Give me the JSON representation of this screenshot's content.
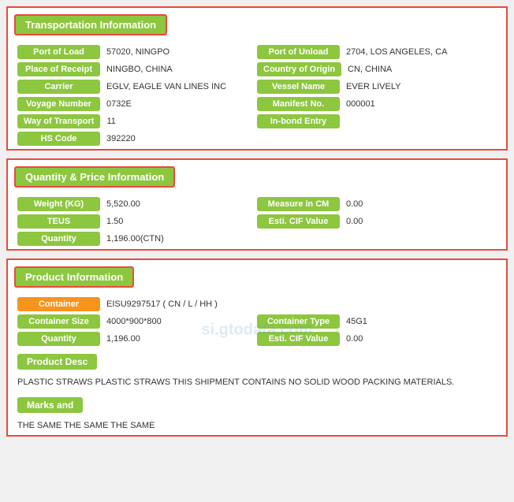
{
  "transportation": {
    "header": "Transportation Information",
    "fields": [
      {
        "label": "Port of Load",
        "value": "57020, NINGPO",
        "label2": "Port of Unload",
        "value2": "2704, LOS ANGELES, CA"
      },
      {
        "label": "Place of Receipt",
        "value": "NINGBO, CHINA",
        "label2": "Country of Origin",
        "value2": "CN, CHINA"
      },
      {
        "label": "Carrier",
        "value": "EGLV, EAGLE VAN LINES INC",
        "label2": "Vessel Name",
        "value2": "EVER LIVELY"
      },
      {
        "label": "Voyage Number",
        "value": "0732E",
        "label2": "Manifest No.",
        "value2": "000001"
      },
      {
        "label": "Way of Transport",
        "value": "11",
        "label2": "In-bond Entry",
        "value2": ""
      },
      {
        "label": "HS Code",
        "value": "392220",
        "label2": "",
        "value2": ""
      }
    ]
  },
  "quantity": {
    "header": "Quantity & Price Information",
    "fields": [
      {
        "label": "Weight (KG)",
        "value": "5,520.00",
        "label2": "Measure in CM",
        "value2": "0.00"
      },
      {
        "label": "TEUS",
        "value": "1.50",
        "label2": "Esti. CIF Value",
        "value2": "0.00"
      },
      {
        "label": "Quantity",
        "value": "1,196.00(CTN)",
        "label2": "",
        "value2": ""
      }
    ]
  },
  "product": {
    "header": "Product Information",
    "container_label": "Container",
    "container_value": "EISU9297517 ( CN / L / HH )",
    "fields": [
      {
        "label": "Container Size",
        "value": "4000*900*800",
        "label2": "Container Type",
        "value2": "45G1"
      },
      {
        "label": "Quantity",
        "value": "1,196.00",
        "label2": "Esti. CIF Value",
        "value2": "0.00"
      }
    ],
    "product_desc_label": "Product Desc",
    "product_desc_text": "PLASTIC STRAWS PLASTIC STRAWS THIS SHIPMENT CONTAINS NO SOLID WOOD PACKING MATERIALS.",
    "marks_label": "Marks and",
    "marks_text": "THE SAME THE SAME THE SAME"
  },
  "watermark": "si.gtodata.com"
}
